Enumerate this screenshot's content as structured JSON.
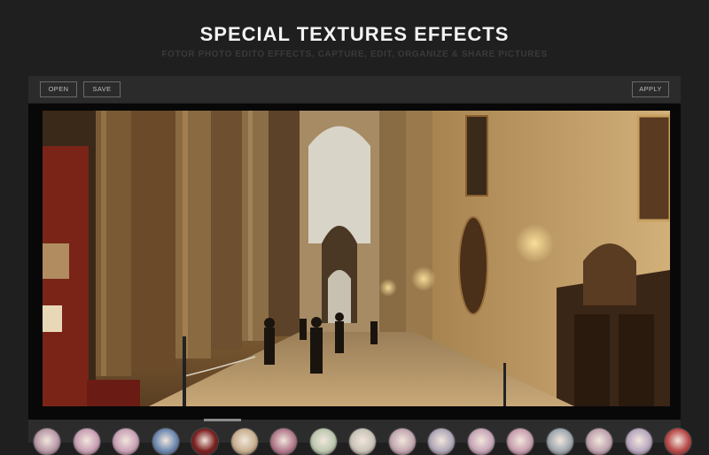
{
  "hero": {
    "title": "SPECIAL TEXTURES EFFECTS",
    "subtitle": "FOTOR PHOTO EDITO EFFECTS, CAPTURE, EDIT, ORGANIZE & SHARE PICTURES"
  },
  "toolbar": {
    "open_label": "OPEN",
    "save_label": "SAVE",
    "apply_label": "APPLY"
  },
  "photo": {
    "description_icon": "cathedral-photo"
  },
  "filmstrip": {
    "thumbnail_colors": [
      "#b89aa8",
      "#c8a0b4",
      "#c9a2b6",
      "#6c88b0",
      "#7a2020",
      "#c8b090",
      "#b27a8c",
      "#bcc8b0",
      "#c9c4b8",
      "#c2a8b0",
      "#b0a8b8",
      "#c6a6b8",
      "#c8a0b0",
      "#a0a8b0",
      "#c0a4b0",
      "#b8a8c0",
      "#b84848"
    ]
  },
  "colors": {
    "background": "#1f1f1f",
    "title": "#f4f4f4",
    "subtitle": "#3a3a3a"
  }
}
